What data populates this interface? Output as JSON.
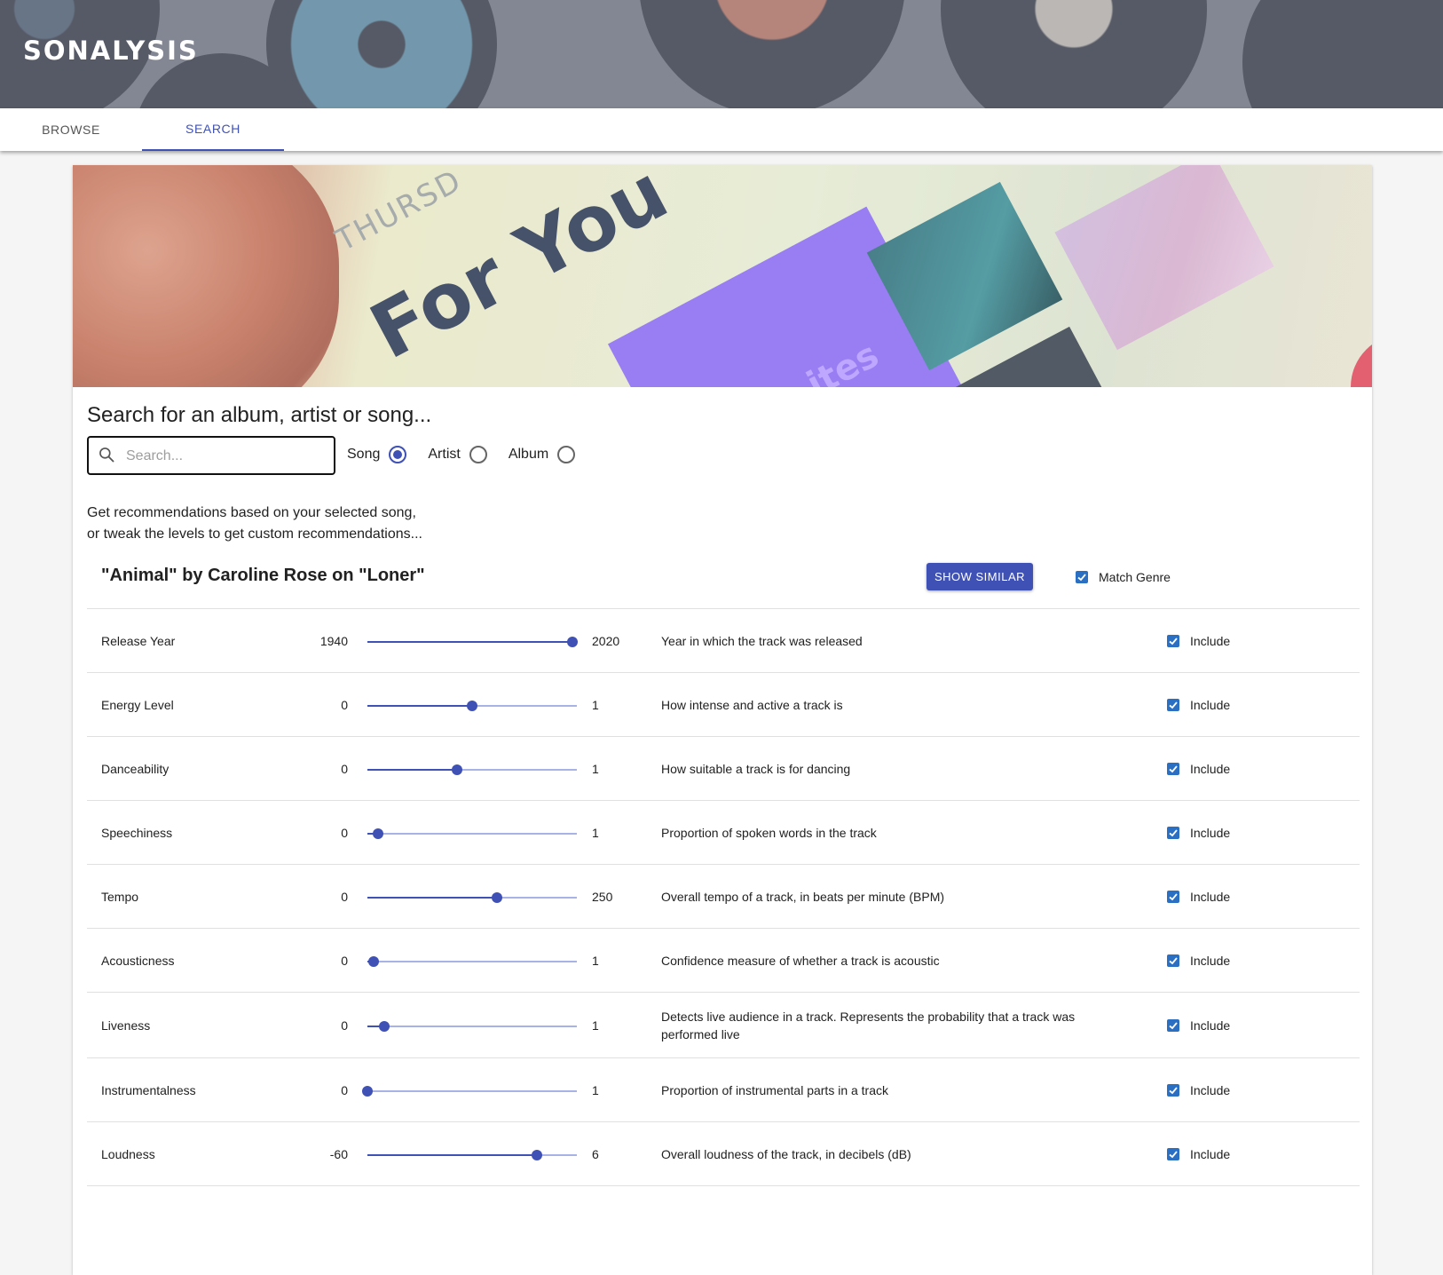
{
  "app": {
    "brand": "SONALYSIS"
  },
  "tabs": [
    {
      "label": "BROWSE",
      "active": false
    },
    {
      "label": "SEARCH",
      "active": true
    }
  ],
  "colors": {
    "primary": "#3f51b5",
    "checkbox": "#2a6fc1"
  },
  "search": {
    "title": "Search for an album, artist or song...",
    "placeholder": "Search...",
    "value": "",
    "options": [
      {
        "label": "Song",
        "checked": true
      },
      {
        "label": "Artist",
        "checked": false
      },
      {
        "label": "Album",
        "checked": false
      }
    ]
  },
  "intro": "Get recommendations based on your selected song,\nor tweak the levels to get custom recommendations...",
  "selected_track": "\"Animal\" by Caroline Rose on \"Loner\"",
  "show_similar_label": "SHOW SIMILAR",
  "match_genre": {
    "label": "Match Genre",
    "checked": true
  },
  "features": [
    {
      "name": "Release Year",
      "min": "1940",
      "max": "2020",
      "value_fraction": 0.98,
      "description": "Year in which the track was released",
      "include_label": "Include",
      "included": true
    },
    {
      "name": "Energy Level",
      "min": "0",
      "max": "1",
      "value_fraction": 0.5,
      "description": "How intense and active a track is",
      "include_label": "Include",
      "included": true
    },
    {
      "name": "Danceability",
      "min": "0",
      "max": "1",
      "value_fraction": 0.43,
      "description": "How suitable a track is for dancing",
      "include_label": "Include",
      "included": true
    },
    {
      "name": "Speechiness",
      "min": "0",
      "max": "1",
      "value_fraction": 0.05,
      "description": "Proportion of spoken words in the track",
      "include_label": "Include",
      "included": true
    },
    {
      "name": "Tempo",
      "min": "0",
      "max": "250",
      "value_fraction": 0.62,
      "description": "Overall tempo of a track, in beats per minute (BPM)",
      "include_label": "Include",
      "included": true
    },
    {
      "name": "Acousticness",
      "min": "0",
      "max": "1",
      "value_fraction": 0.03,
      "description": "Confidence measure of whether a track is acoustic",
      "include_label": "Include",
      "included": true
    },
    {
      "name": "Liveness",
      "min": "0",
      "max": "1",
      "value_fraction": 0.08,
      "description": "Detects live audience in a track. Represents the probability that a track was performed live",
      "include_label": "Include",
      "included": true
    },
    {
      "name": "Instrumentalness",
      "min": "0",
      "max": "1",
      "value_fraction": 0.0,
      "description": "Proportion of instrumental parts in a track",
      "include_label": "Include",
      "included": true
    },
    {
      "name": "Loudness",
      "min": "-60",
      "max": "6",
      "value_fraction": 0.81,
      "description": "Overall loudness of the track, in decibels (dB)",
      "include_label": "Include",
      "included": true
    }
  ]
}
